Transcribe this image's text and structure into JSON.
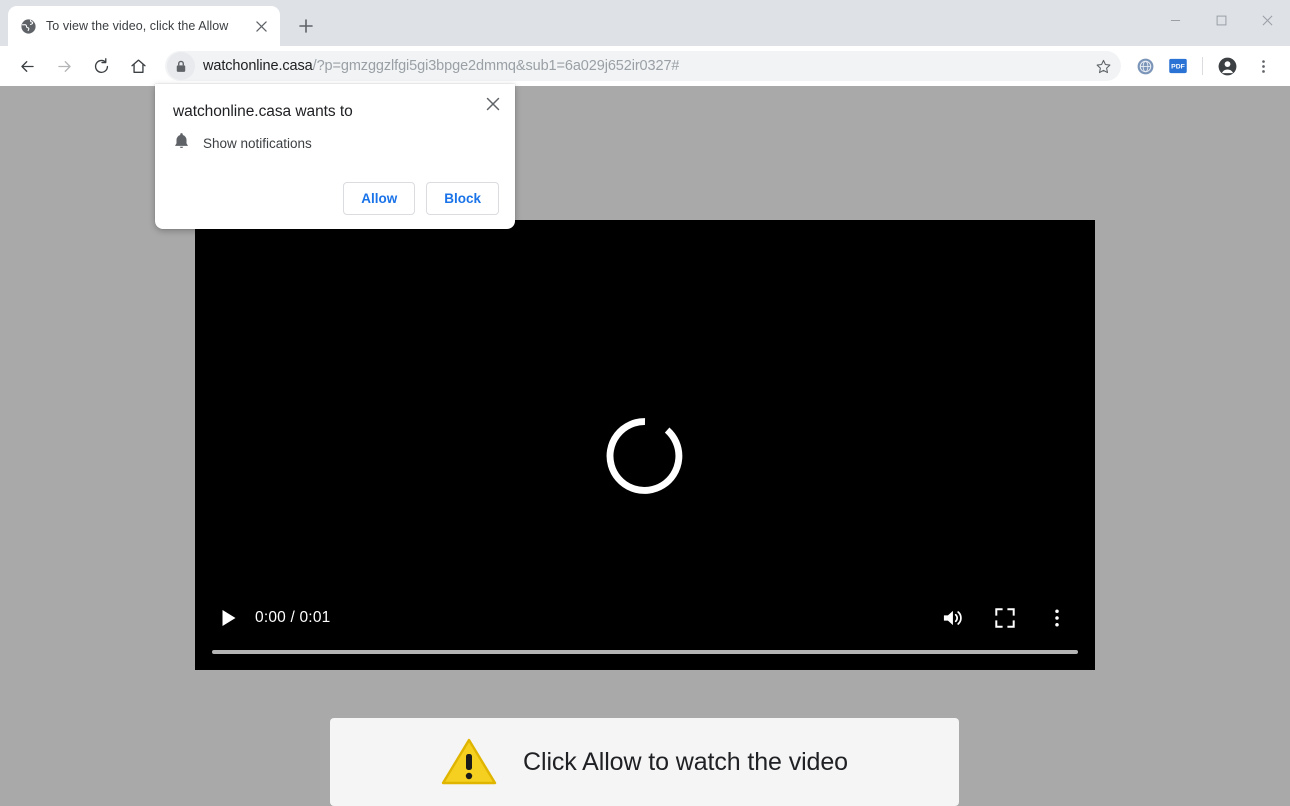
{
  "browser": {
    "tab": {
      "title": "To view the video, click the Allow",
      "favicon_name": "globe-icon",
      "close_label": "×"
    },
    "new_tab_label": "+",
    "window_controls": {
      "minimize": "–",
      "maximize": "□",
      "close": "×"
    },
    "nav": {
      "back": "←",
      "forward": "→",
      "reload": "↻",
      "home": "⌂"
    },
    "omnibox": {
      "lock_icon": "lock-icon",
      "domain": "watchonline.casa",
      "path": "/?p=gmzggzlfgi5gi3bpge2dmmq&sub1=6a029j652ir0327#",
      "full_url": "watchonline.casa/?p=gmzggzlfgi5gi3bpge2dmmq&sub1=6a029j652ir0327#",
      "star_label": "Bookmark this tab"
    },
    "extensions": [
      {
        "name": "globe-extension-icon",
        "label": ""
      },
      {
        "name": "pdf-extension-icon",
        "label": "PDF"
      }
    ],
    "profile_label": "Profile",
    "menu_label": "Customize and control Google Chrome"
  },
  "permission_dialog": {
    "title": "watchonline.casa wants to",
    "permission_icon": "bell-icon",
    "permission_label": "Show notifications",
    "allow_label": "Allow",
    "block_label": "Block",
    "close_label": "×"
  },
  "video_player": {
    "state": "loading",
    "spinner_name": "loading-spinner",
    "play_label": "Play",
    "time_current": "0:00",
    "time_separator": "/",
    "time_total": "0:01",
    "time_display": "0:00 / 0:01",
    "controls": {
      "volume": "volume-icon",
      "fullscreen": "fullscreen-icon",
      "more_options": "more-options-icon"
    },
    "progress_percent": 0
  },
  "banner": {
    "icon_name": "warning-triangle-icon",
    "text": "Click Allow to watch the video"
  },
  "colors": {
    "tabstrip_bg": "#dee1e6",
    "toolbar_bg": "#ffffff",
    "page_bg": "#a9a9a9",
    "video_bg": "#000000",
    "banner_bg": "#f5f5f5",
    "accent_blue": "#1a73e8",
    "warning_yellow": "#f5d020",
    "pdf_blue": "#2a72d4"
  }
}
